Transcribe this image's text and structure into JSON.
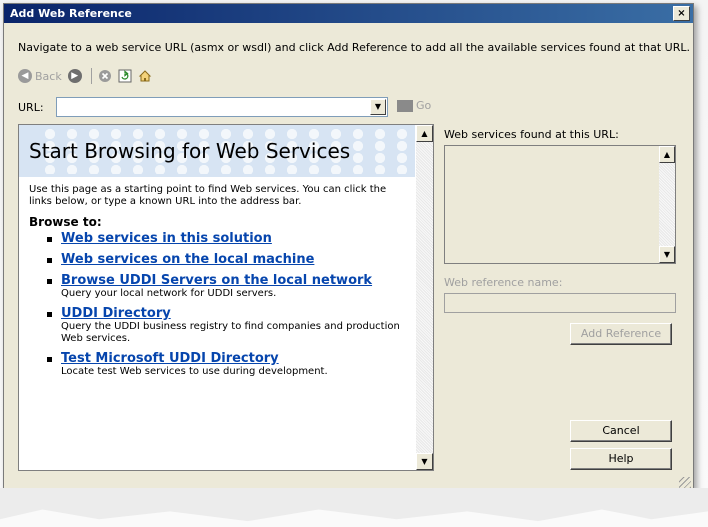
{
  "window": {
    "title": "Add Web Reference",
    "close_glyph": "×"
  },
  "instructions": "Navigate to a web service URL (asmx or wsdl) and click Add Reference to add all the available services found at that URL.",
  "toolbar": {
    "back_label": "Back",
    "back_icon": "back-arrow-icon",
    "forward_icon": "forward-arrow-icon",
    "stop_icon": "stop-icon",
    "refresh_icon": "refresh-icon",
    "home_icon": "home-icon"
  },
  "url": {
    "label": "URL:",
    "value": "",
    "go_label": "Go"
  },
  "browser": {
    "heading": "Start Browsing for Web Services",
    "intro": "Use this page as a starting point to find Web services. You can click the links below, or type a known URL into the address bar.",
    "browse_to": "Browse to:",
    "links": [
      {
        "label": "Web services in this solution",
        "desc": ""
      },
      {
        "label": "Web services on the local machine",
        "desc": ""
      },
      {
        "label": "Browse UDDI Servers on the local network",
        "desc": "Query your local network for UDDI servers."
      },
      {
        "label": "UDDI Directory",
        "desc": "Query the UDDI business registry to find companies and production Web services."
      },
      {
        "label": "Test Microsoft UDDI Directory",
        "desc": "Locate test Web services to use during development."
      }
    ]
  },
  "right_panel": {
    "found_label": "Web services found at this URL:",
    "refname_label": "Web reference name:",
    "refname_value": "",
    "add_reference": "Add Reference",
    "cancel": "Cancel",
    "help": "Help"
  },
  "colors": {
    "dialog_bg": "#ece9d8",
    "link": "#0645ad",
    "banner": "#d7e4f3"
  }
}
